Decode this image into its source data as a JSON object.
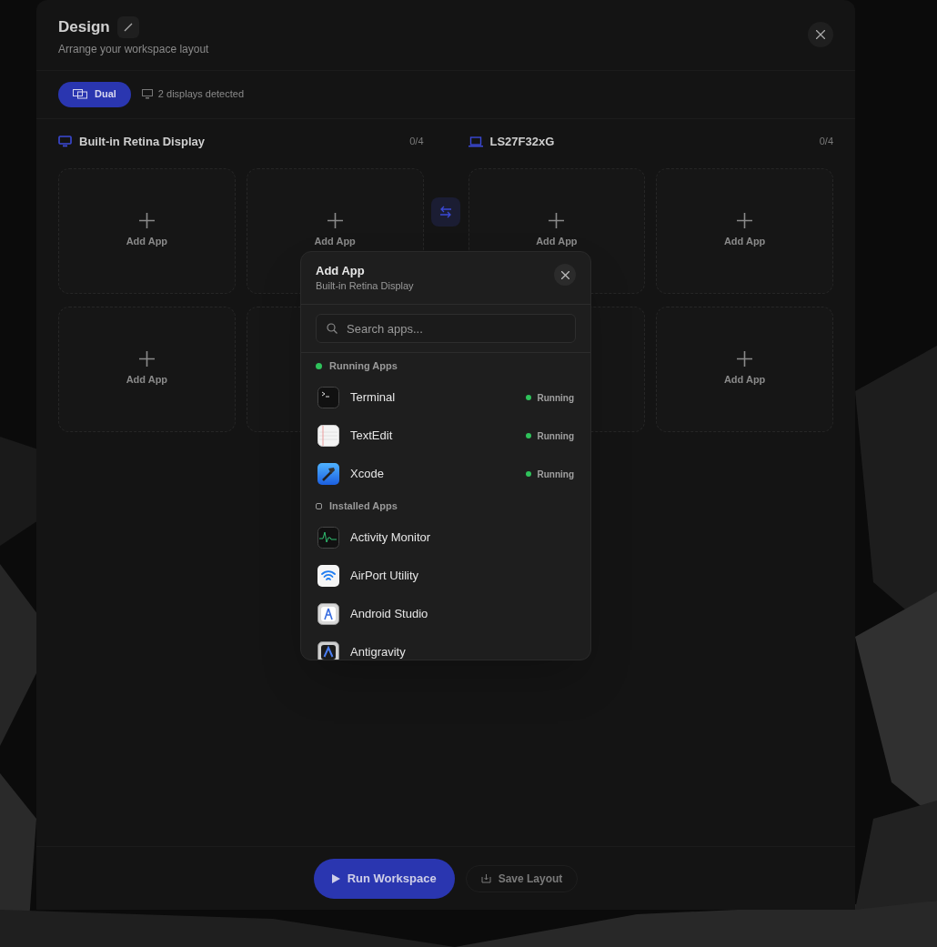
{
  "header": {
    "title": "Design",
    "subtitle": "Arrange your workspace layout"
  },
  "mode": {
    "label": "Dual",
    "selected": true,
    "status": "2 displays detected"
  },
  "displays": [
    {
      "name": "Built-in Retina Display",
      "count": "0/4",
      "slots": [
        {
          "kind": "add",
          "label": "Add App"
        },
        {
          "kind": "add",
          "label": "Add App"
        },
        {
          "kind": "add",
          "label": "Add App"
        },
        {
          "kind": "covered"
        }
      ]
    },
    {
      "name": "LS27F32xG",
      "count": "0/4",
      "slots": [
        {
          "kind": "add",
          "label": "Add App"
        },
        {
          "kind": "add",
          "label": "Add App"
        },
        {
          "kind": "covered"
        },
        {
          "kind": "add",
          "label": "Add App"
        }
      ]
    }
  ],
  "popup": {
    "title": "Add App",
    "subtitle": "Built-in Retina Display",
    "search_placeholder": "Search apps...",
    "sections": [
      {
        "kind": "running",
        "title": "Running Apps",
        "apps": [
          {
            "name": "Terminal",
            "status": "Running"
          },
          {
            "name": "TextEdit",
            "status": "Running"
          },
          {
            "name": "Xcode",
            "status": "Running"
          }
        ]
      },
      {
        "kind": "installed",
        "title": "Installed Apps",
        "apps": [
          {
            "name": "Activity Monitor"
          },
          {
            "name": "AirPort Utility"
          },
          {
            "name": "Android Studio"
          },
          {
            "name": "Antigravity"
          }
        ]
      }
    ]
  },
  "footer": {
    "primary": "Run Workspace",
    "secondary": "Save Layout"
  }
}
